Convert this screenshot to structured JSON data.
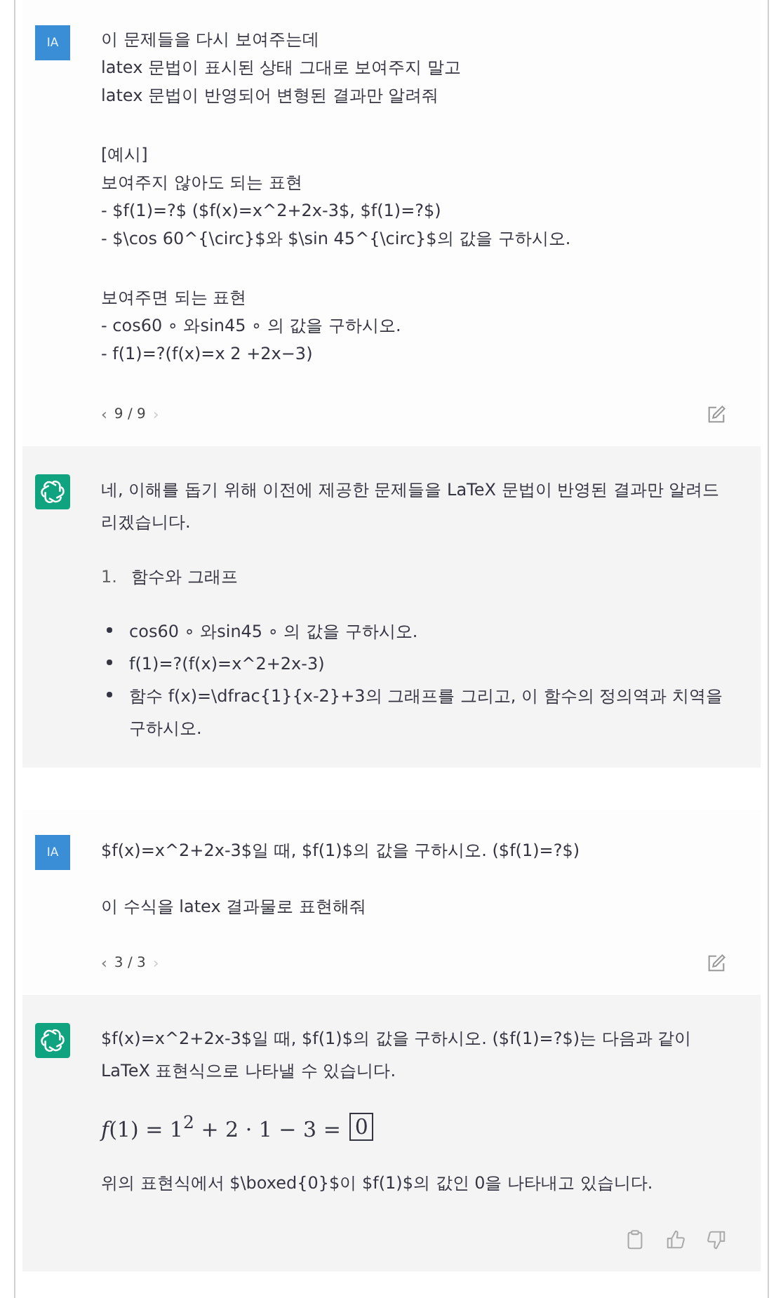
{
  "messages": [
    {
      "kind": "user",
      "avatar": "IA",
      "blocks": [
        {
          "kind": "lines",
          "lines": [
            "이 문제들을 다시 보여주는데",
            "latex 문법이 표시된 상태 그대로 보여주지 말고",
            "latex 문법이 반영되어 변형된 결과만 알려줘"
          ]
        },
        {
          "kind": "lines",
          "lines": [
            "[예시]",
            "보여주지 않아도 되는 표현",
            "- $f(1)=?$ ($f(x)=x^2+2x-3$, $f(1)=?$)",
            "- $\\cos 60^{\\circ}$와 $\\sin 45^{\\circ}$의 값을 구하시오."
          ]
        },
        {
          "kind": "lines",
          "lines": [
            "보여주면 되는 표현",
            "- cos60 ∘ 와sin45 ∘ 의 값을 구하시오.",
            "- f(1)=?(f(x)=x 2 +2x−3)"
          ]
        }
      ],
      "pager": {
        "prev": "‹",
        "text": "9 / 9",
        "next": "›"
      }
    },
    {
      "kind": "assistant",
      "blocks": [
        {
          "kind": "paragraph",
          "text": "네, 이해를 돕기 위해 이전에 제공한 문제들을 LaTeX 문법이 반영된 결과만 알려드리겠습니다."
        },
        {
          "kind": "ordered",
          "items": [
            {
              "number": "1.",
              "text": "함수와 그래프"
            }
          ]
        },
        {
          "kind": "bullets",
          "items": [
            "cos60 ∘ 와sin45 ∘ 의 값을 구하시오.",
            "f(1)=?(f(x)=x^2+2x-3)",
            "함수 f(x)=\\dfrac{1}{x-2}+3의 그래프를 그리고, 이 함수의 정의역과 치역을 구하시오."
          ]
        }
      ]
    },
    {
      "kind": "user",
      "avatar": "IA",
      "blocks": [
        {
          "kind": "paragraph",
          "text": "$f(x)=x^2+2x-3$일 때, $f(1)$의 값을 구하시오. ($f(1)=?$)"
        },
        {
          "kind": "paragraph",
          "text": "이 수식을 latex 결과물로 표현해줘"
        }
      ],
      "pager": {
        "prev": "‹",
        "text": "3 / 3",
        "next": "›"
      }
    },
    {
      "kind": "assistant",
      "blocks": [
        {
          "kind": "paragraph",
          "text": "$f(x)=x^2+2x-3$일 때, $f(1)$의 값을 구하시오. ($f(1)=?$)는 다음과 같이 LaTeX 표현식으로 나타낼 수 있습니다."
        },
        {
          "kind": "math",
          "expr": "*f*(1) = 1$^{2}$ + 2 · 1 − 3 =",
          "boxed": "0"
        },
        {
          "kind": "paragraph",
          "text": "위의 표현식에서 $\\boxed{0}$이 $f(1)$의 값인 0을 나타내고 있습니다."
        }
      ],
      "feedback": true
    }
  ]
}
